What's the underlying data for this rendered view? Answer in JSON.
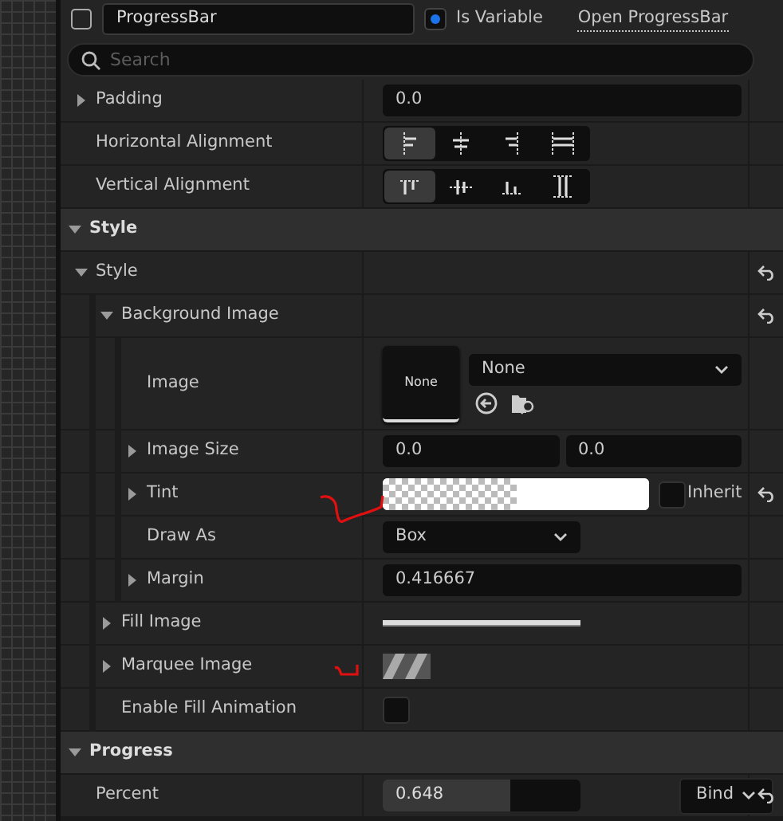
{
  "header": {
    "name_field": "ProgressBar",
    "is_variable": {
      "label": "Is Variable",
      "checked": true
    },
    "open_link": "Open ProgressBar"
  },
  "search": {
    "placeholder": "Search"
  },
  "rows": [
    {
      "kind": "text",
      "label": "Padding",
      "expanded": false,
      "value": "0.0",
      "resettable": false
    },
    {
      "kind": "halign",
      "label": "Horizontal Alignment",
      "resettable": false,
      "options": [
        {
          "selected": true
        },
        {
          "selected": false
        },
        {
          "selected": false
        },
        {
          "selected": false
        }
      ]
    },
    {
      "kind": "valign",
      "label": "Vertical Alignment",
      "resettable": false,
      "options": [
        {
          "selected": true
        },
        {
          "selected": false
        },
        {
          "selected": false
        },
        {
          "selected": false
        }
      ]
    },
    {
      "kind": "section",
      "label": "Style",
      "expanded": true,
      "children": [
        {
          "kind": "group",
          "label": "Style",
          "expanded": true,
          "resettable": true,
          "children": [
            {
              "kind": "group",
              "label": "Background Image",
              "expanded": true,
              "resettable": true,
              "children": [
                {
                  "kind": "image",
                  "label": "Image",
                  "thumbnail": "None",
                  "value": "None",
                  "resettable": false
                },
                {
                  "kind": "vec2",
                  "label": "Image Size",
                  "expanded": false,
                  "values": [
                    "0.0",
                    "0.0"
                  ],
                  "resettable": false
                },
                {
                  "kind": "color",
                  "label": "Tint",
                  "expanded": false,
                  "color": "#ffffff",
                  "inherit": {
                    "label": "Inherit",
                    "checked": false
                  },
                  "resettable": true
                },
                {
                  "kind": "dropdown",
                  "label": "Draw As",
                  "value": "Box",
                  "resettable": false
                },
                {
                  "kind": "text",
                  "label": "Margin",
                  "expanded": false,
                  "value": "0.416667",
                  "resettable": false
                }
              ]
            },
            {
              "kind": "brush_bar",
              "label": "Fill Image",
              "expanded": false,
              "resettable": false
            },
            {
              "kind": "brush_marquee",
              "label": "Marquee Image",
              "expanded": false,
              "resettable": false
            },
            {
              "kind": "checkbox",
              "label": "Enable Fill Animation",
              "checked": false,
              "resettable": false
            }
          ]
        }
      ]
    },
    {
      "kind": "section",
      "label": "Progress",
      "expanded": true,
      "children": [
        {
          "kind": "percent",
          "label": "Percent",
          "value": "0.648",
          "level": 0.648,
          "bind": "Bind",
          "resettable": true
        }
      ]
    }
  ]
}
